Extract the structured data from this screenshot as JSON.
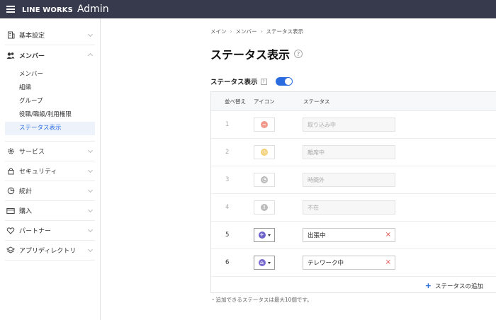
{
  "app": {
    "brand": "LINE WORKS",
    "suffix": "Admin"
  },
  "sidebar": {
    "items": [
      {
        "label": "基本設定",
        "icon": "building-icon"
      },
      {
        "label": "メンバー",
        "icon": "users-icon",
        "expanded": true
      },
      {
        "label": "サービス",
        "icon": "gear-icon"
      },
      {
        "label": "セキュリティ",
        "icon": "lock-icon"
      },
      {
        "label": "統計",
        "icon": "pie-chart-icon"
      },
      {
        "label": "購入",
        "icon": "card-icon"
      },
      {
        "label": "パートナー",
        "icon": "handshake-icon"
      },
      {
        "label": "アプリディレクトリ",
        "icon": "layers-icon"
      }
    ],
    "sub_items": [
      {
        "label": "メンバー"
      },
      {
        "label": "組織"
      },
      {
        "label": "グループ"
      },
      {
        "label": "役職/職級/利用権限"
      },
      {
        "label": "ステータス表示",
        "active": true
      }
    ]
  },
  "breadcrumb": [
    "メイン",
    "メンバー",
    "ステータス表示"
  ],
  "page": {
    "title": "ステータス表示",
    "help": "?"
  },
  "toggle": {
    "label": "ステータス表示",
    "help": "?",
    "on": true
  },
  "table": {
    "headers": {
      "sort": "並べ替え",
      "icon": "アイコン",
      "status": "ステータス"
    },
    "rows": [
      {
        "num": "1",
        "status": "取り込み中",
        "enabled": false,
        "icon_color": "#f1998b",
        "icon_glyph": "−"
      },
      {
        "num": "2",
        "status": "離席中",
        "enabled": false,
        "icon_color": "#f3cf74",
        "icon_glyph": "◷"
      },
      {
        "num": "3",
        "status": "時間外",
        "enabled": false,
        "icon_color": "#bcbcbc",
        "icon_glyph": "◔"
      },
      {
        "num": "4",
        "status": "不在",
        "enabled": false,
        "icon_color": "#bcbcbc",
        "icon_glyph": "!"
      },
      {
        "num": "5",
        "status": "出張中",
        "enabled": true,
        "icon_color": "#6c62c9",
        "icon_glyph": "✈"
      },
      {
        "num": "6",
        "status": "テレワーク中",
        "enabled": true,
        "icon_color": "#7a6bd1",
        "icon_glyph": "⌂"
      }
    ],
    "add_label": "ステータスの追加"
  },
  "note": "・追加できるステータスは最大10個です。"
}
